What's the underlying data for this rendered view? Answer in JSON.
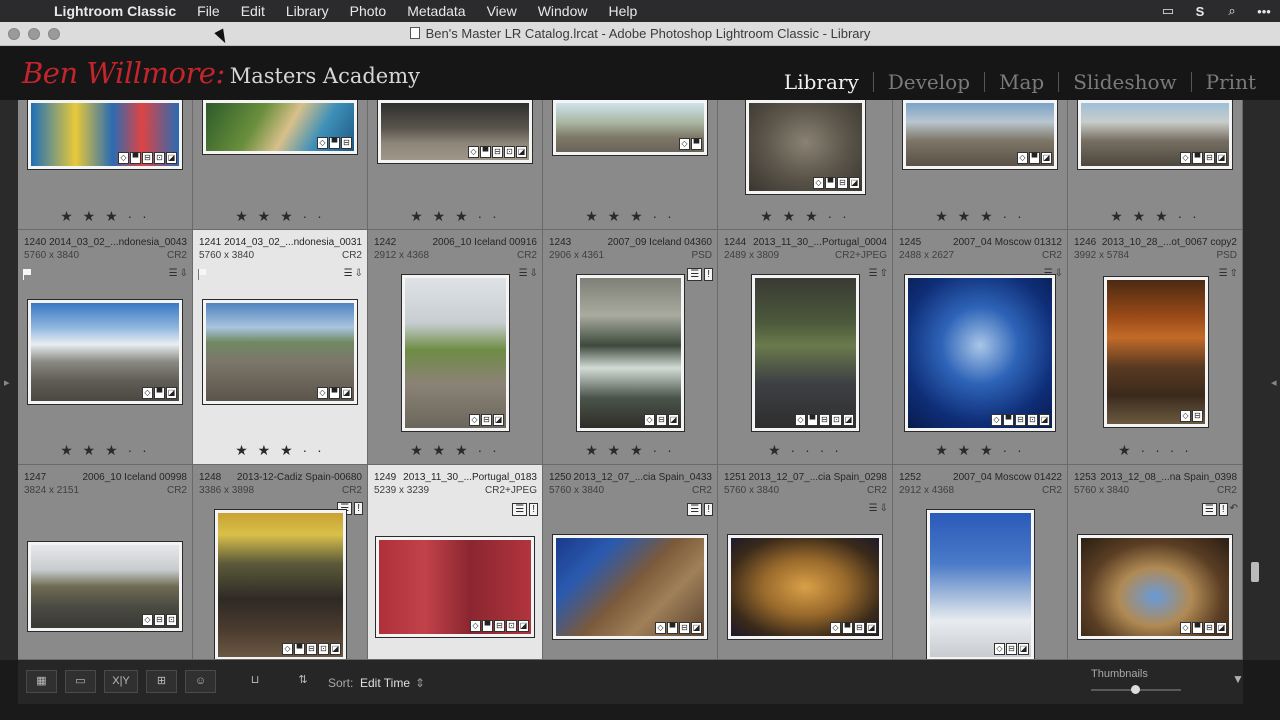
{
  "menubar": {
    "app": "Lightroom Classic",
    "items": [
      "File",
      "Edit",
      "Library",
      "Photo",
      "Metadata",
      "View",
      "Window",
      "Help"
    ],
    "status_icons": [
      "window-icon",
      "creative-cloud-icon",
      "spotlight-search-icon",
      "more-icon"
    ]
  },
  "window": {
    "title": "Ben's Master LR Catalog.lrcat - Adobe Photoshop Lightroom Classic - Library"
  },
  "identity": {
    "signature": "Ben Willmore:",
    "academy": "Masters Academy"
  },
  "modules": [
    "Library",
    "Develop",
    "Map",
    "Slideshow",
    "Print"
  ],
  "active_module": "Library",
  "top_row": {
    "stars": [
      "★ ★ ★ · ·",
      "★ ★ ★ · ·",
      "★ ★ ★ · ·",
      "★ ★ ★ · ·",
      "★ ★ ★ · ·",
      "★ ★ ★ · ·",
      "★ ★ ★ · ·"
    ]
  },
  "row2": [
    {
      "index": "1240",
      "name": "2014_03_02_...ndonesia_0043",
      "dims": "5760 x 3840",
      "type": "CR2",
      "stars": "★ ★ ★ · ·",
      "flag": true
    },
    {
      "index": "1241",
      "name": "2014_03_02_...ndonesia_0031",
      "dims": "5760 x 3840",
      "type": "CR2",
      "stars": "★ ★ ★ · ·",
      "flag": true
    },
    {
      "index": "1242",
      "name": "2006_10 Iceland 00916",
      "dims": "2912 x 4368",
      "type": "CR2",
      "stars": "★ ★ ★ · ·",
      "flag": false
    },
    {
      "index": "1243",
      "name": "2007_09 Iceland 04360",
      "dims": "2906 x 4361",
      "type": "PSD",
      "stars": "★ ★ ★ · ·",
      "flag": false
    },
    {
      "index": "1244",
      "name": "2013_11_30_...Portugal_0004",
      "dims": "2489 x 3809",
      "type": "CR2+JPEG",
      "stars": "★ · · · ·",
      "flag": false
    },
    {
      "index": "1245",
      "name": "2007_04 Moscow 01312",
      "dims": "2488 x 2627",
      "type": "CR2",
      "stars": "★ ★ ★ · ·",
      "flag": false
    },
    {
      "index": "1246",
      "name": "2013_10_28_...ot_0067 copy2",
      "dims": "3992 x 5784",
      "type": "PSD",
      "stars": "★ · · · ·",
      "flag": false
    }
  ],
  "row3": [
    {
      "index": "1247",
      "name": "2006_10 Iceland 00998",
      "dims": "3824 x 2151",
      "type": "CR2"
    },
    {
      "index": "1248",
      "name": "2013-12-Cadiz Spain-00680",
      "dims": "3386 x 3898",
      "type": "CR2"
    },
    {
      "index": "1249",
      "name": "2013_11_30_...Portugal_0183",
      "dims": "5239 x 3239",
      "type": "CR2+JPEG"
    },
    {
      "index": "1250",
      "name": "2013_12_07_...cia Spain_0433",
      "dims": "5760 x 3840",
      "type": "CR2"
    },
    {
      "index": "1251",
      "name": "2013_12_07_...cia Spain_0298",
      "dims": "5760 x 3840",
      "type": "CR2"
    },
    {
      "index": "1252",
      "name": "2007_04 Moscow 01422",
      "dims": "2912 x 4368",
      "type": "CR2"
    },
    {
      "index": "1253",
      "name": "2013_12_08_...na Spain_0398",
      "dims": "5760 x 3840",
      "type": "CR2"
    }
  ],
  "toolbar": {
    "sort_label": "Sort:",
    "sort_value": "Edit Time",
    "thumbnails_label": "Thumbnails",
    "thumbnail_size": 0.45,
    "view_buttons": [
      "grid-view-icon",
      "loupe-view-icon",
      "compare-view-icon",
      "survey-view-icon",
      "people-view-icon"
    ],
    "compare_label": "X|Y"
  },
  "colors": {
    "accent_red": "#c2252b",
    "grid_cell": "#8a8a8a",
    "selected_cell": "#e6e6e6"
  }
}
